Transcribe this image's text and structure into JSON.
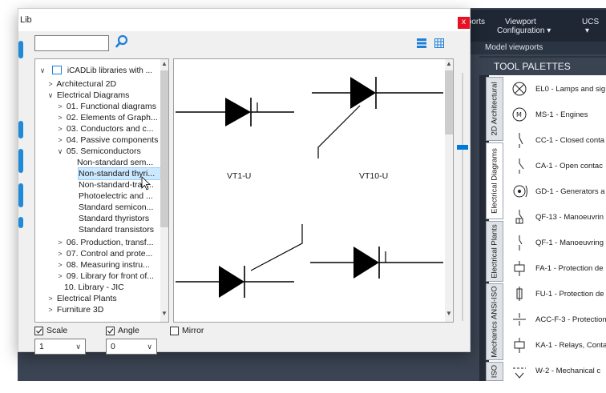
{
  "dialog": {
    "title": "Lib",
    "close": "x",
    "search": {
      "value": "",
      "placeholder": ""
    }
  },
  "tree": {
    "items": [
      {
        "label": "iCADLib libraries with ...",
        "arrow": "∨"
      },
      {
        "label": "Architectural 2D",
        "arrow": ">"
      },
      {
        "label": "Electrical Diagrams",
        "arrow": "∨"
      },
      {
        "label": "01. Functional diagrams",
        "arrow": ">"
      },
      {
        "label": "02. Elements of Graph...",
        "arrow": ">"
      },
      {
        "label": "03. Conductors and c...",
        "arrow": ">"
      },
      {
        "label": "04. Passive components",
        "arrow": ">"
      },
      {
        "label": "05. Semiconductors",
        "arrow": "∨"
      },
      {
        "label": "Non-standard sem...",
        "arrow": ""
      },
      {
        "label": "Non-standard thyri...",
        "arrow": ""
      },
      {
        "label": "Non-standard-tran...",
        "arrow": ""
      },
      {
        "label": "Photoelectric and ...",
        "arrow": ""
      },
      {
        "label": "Standard semicon...",
        "arrow": ""
      },
      {
        "label": "Standard thyristors",
        "arrow": ""
      },
      {
        "label": "Standard transistors",
        "arrow": ""
      },
      {
        "label": "06. Production, transf...",
        "arrow": ">"
      },
      {
        "label": "07. Control and prote...",
        "arrow": ">"
      },
      {
        "label": "08. Measuring instru...",
        "arrow": ">"
      },
      {
        "label": "09. Library for front of...",
        "arrow": ">"
      },
      {
        "label": "10. Library - JIC",
        "arrow": ""
      },
      {
        "label": "Electrical Plants",
        "arrow": ">"
      },
      {
        "label": "Furniture 3D",
        "arrow": ">"
      }
    ]
  },
  "preview": {
    "items": [
      {
        "label": "VT1-U"
      },
      {
        "label": "VT10-U"
      }
    ]
  },
  "options": {
    "scale_label": "Scale",
    "scale_value": "1",
    "angle_label": "Angle",
    "angle_value": "0",
    "mirror_label": "Mirror"
  },
  "background": {
    "ribbon_tabs": [
      "ewports",
      "Viewport",
      "Configuration ▾",
      "UCS",
      "▾"
    ],
    "ribbon_group": "Model viewports",
    "palette_title": "TOOL PALETTES",
    "side_tabs": [
      "2D Architectural",
      "Electrical Diagrams",
      "Electrical Plants",
      "Mechanics ANSI-ISO",
      "ISO"
    ],
    "palette_items": [
      "EL0 - Lamps and sig",
      "MS-1 - Engines",
      "CC-1 - Closed conta",
      "CA-1 - Open contac",
      "GD-1 - Generators a",
      "QF-13 - Manoeuvrin",
      "QF-1 - Manoeuvring",
      "FA-1 - Protection de",
      "FU-1 - Protection de",
      "ACC-F-3 - Protection",
      "KA-1 - Relays, Conta",
      "W-2 - Mechanical c"
    ]
  },
  "colors": {
    "accent": "#0078d7",
    "close": "#e81123",
    "selection": "#cce8ff",
    "ribbon": "#1e2733"
  }
}
